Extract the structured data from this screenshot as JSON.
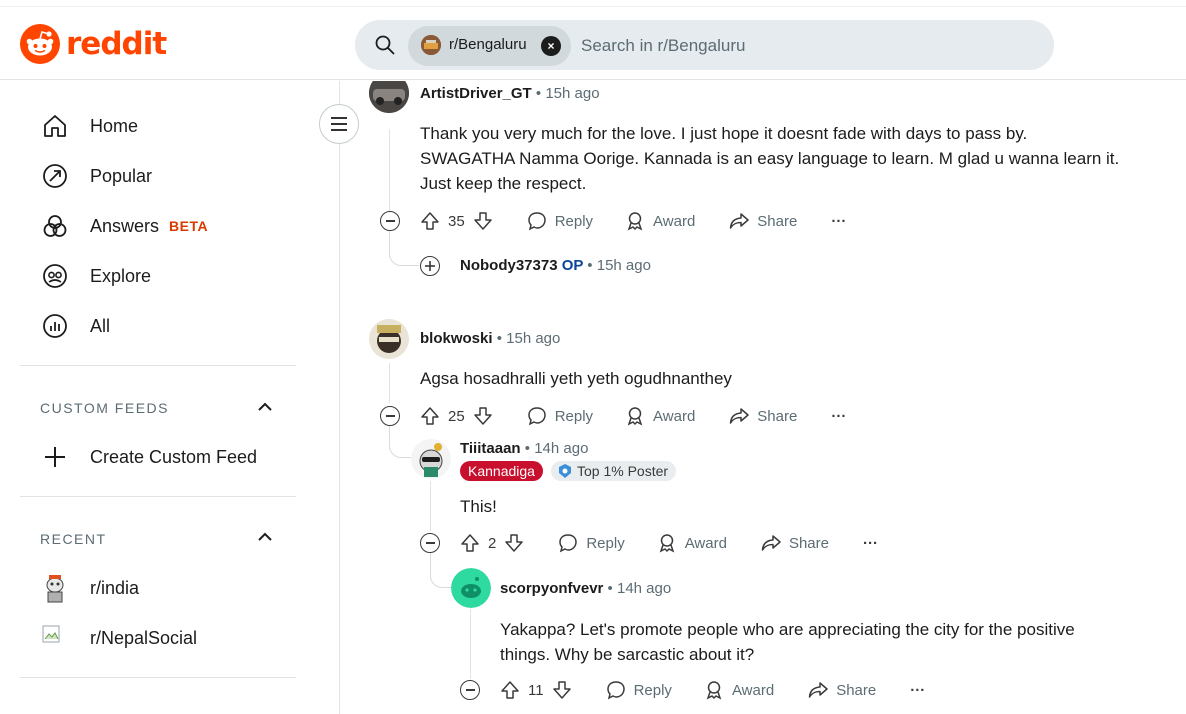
{
  "header": {
    "logo_text": "reddit",
    "search_chip_label": "r/Bengaluru",
    "search_placeholder": "Search in r/Bengaluru",
    "brand_color": "#ff4500"
  },
  "sidebar": {
    "nav": [
      {
        "label": "Home",
        "icon": "home-icon"
      },
      {
        "label": "Popular",
        "icon": "popular-icon"
      },
      {
        "label": "Answers",
        "badge": "BETA",
        "icon": "answers-icon"
      },
      {
        "label": "Explore",
        "icon": "explore-icon"
      },
      {
        "label": "All",
        "icon": "all-icon"
      }
    ],
    "custom_feeds": {
      "title": "CUSTOM FEEDS",
      "create_label": "Create Custom Feed"
    },
    "recent": {
      "title": "RECENT",
      "items": [
        {
          "label": "r/india"
        },
        {
          "label": "r/NepalSocial"
        }
      ]
    }
  },
  "comments": [
    {
      "author": "ArtistDriver_GT",
      "time": "15h ago",
      "lines": [
        "Thank you very much for the love. I just hope it doesnt fade with days to pass by.",
        "SWAGATHA Namma Oorige. Kannada is an easy language to learn. M glad u wanna learn it.",
        "Just keep the respect."
      ],
      "votes": "35"
    },
    {
      "author": "Nobody37373",
      "op_label": "OP",
      "time": "15h ago"
    },
    {
      "author": "blokwoski",
      "time": "15h ago",
      "lines": [
        "Agsa hosadhralli yeth yeth ogudhnanthey"
      ],
      "votes": "25"
    },
    {
      "author": "Tiiitaaan",
      "time": "14h ago",
      "flair": "Kannadiga",
      "badge": "Top 1% Poster",
      "lines": [
        "This!"
      ],
      "votes": "2"
    },
    {
      "author": "scorpyonfvevr",
      "time": "14h ago",
      "lines": [
        "Yakappa? Let's promote people who are appreciating the city for the positive",
        "things. Why be sarcastic about it?"
      ],
      "votes": "11"
    }
  ],
  "actions": {
    "reply": "Reply",
    "award": "Award",
    "share": "Share",
    "more": "···"
  },
  "separator": "•",
  "colors": {
    "flair_bg": "#c8102e",
    "op": "#0a449b",
    "beta": "#d93a00"
  }
}
